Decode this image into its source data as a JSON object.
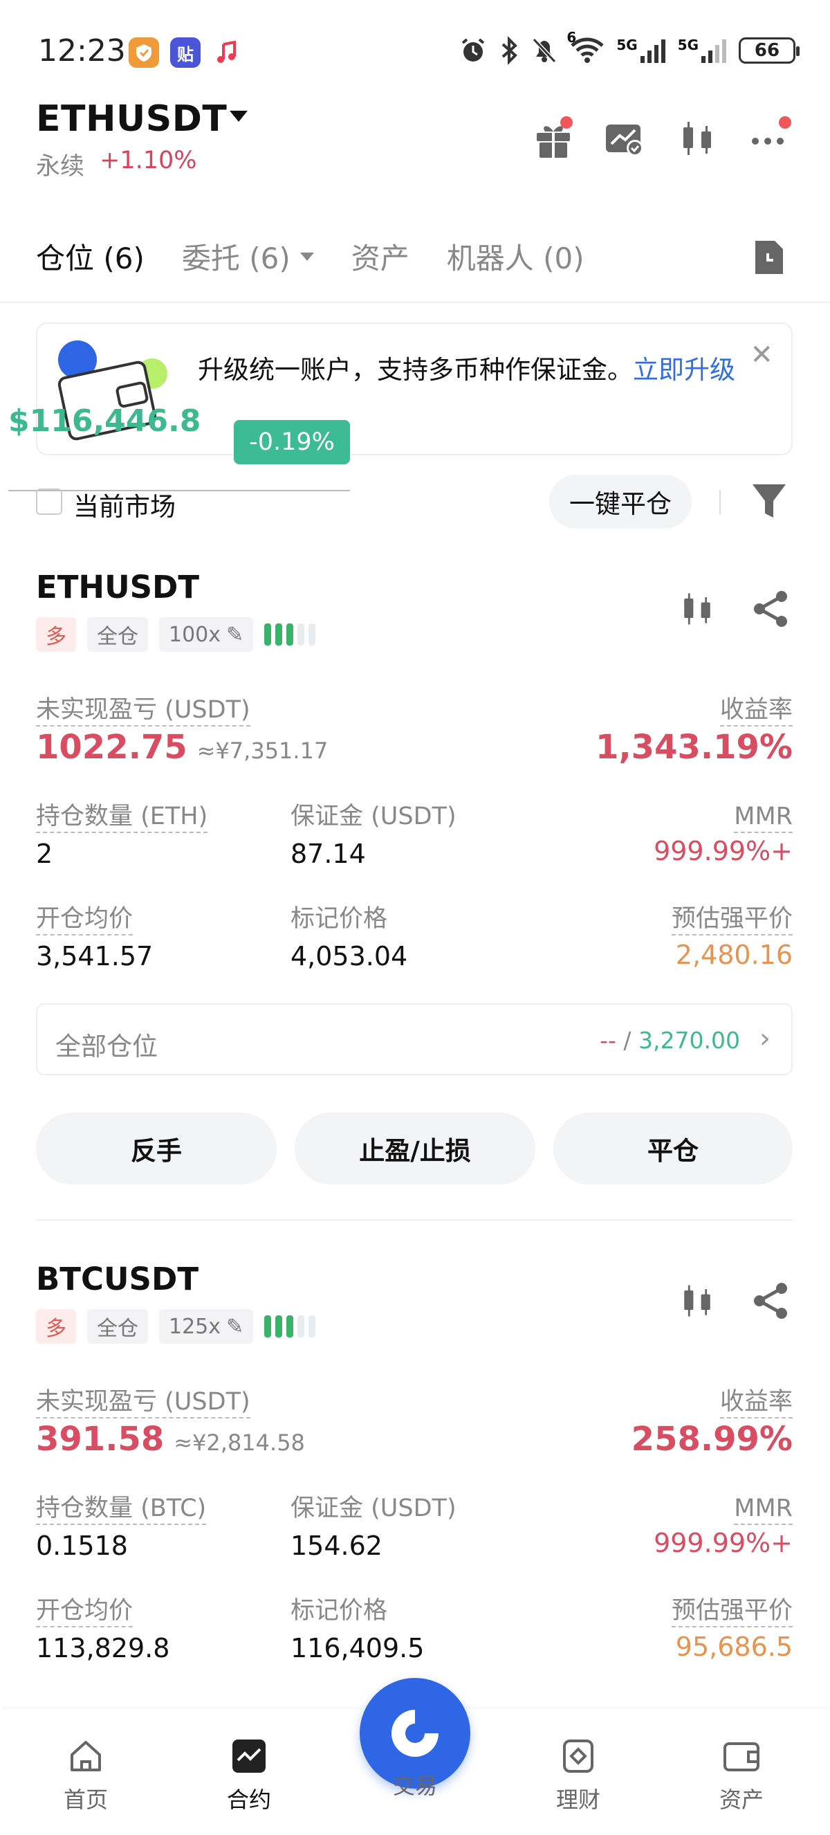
{
  "status": {
    "time": "12:23",
    "battery": "66",
    "signal1": "5G",
    "signal2": "5G",
    "wifi_sub": "6",
    "app2_char": "贴"
  },
  "header": {
    "pair": "ETHUSDT",
    "perp_label": "永续",
    "change": "+1.10%"
  },
  "tabs": [
    {
      "label": "仓位 (6)",
      "active": true
    },
    {
      "label": "委托 (6)",
      "active": false
    },
    {
      "label": "资产",
      "active": false
    },
    {
      "label": "机器人 (0)",
      "active": false
    }
  ],
  "banner": {
    "text": "升级统一账户，支持多币种作保证金。",
    "link": "立即升级"
  },
  "floating": {
    "price": "$116,446.8",
    "change": "-0.19%"
  },
  "filter": {
    "current_market": "当前市场",
    "close_all": "一键平仓"
  },
  "positions": [
    {
      "symbol": "ETHUSDT",
      "side": "多",
      "margin_mode": "全仓",
      "leverage": "100x",
      "pnl_label": "未实现盈亏 (USDT)",
      "pnl": "1022.75",
      "pnl_cny": "≈¥7,351.17",
      "roi_label": "收益率",
      "roi": "1,343.19%",
      "size_label": "持仓数量 (ETH)",
      "size": "2",
      "margin_label": "保证金 (USDT)",
      "margin": "87.14",
      "mmr_label": "MMR",
      "mmr": "999.99%+",
      "entry_label": "开仓均价",
      "entry": "3,541.57",
      "mark_label": "标记价格",
      "mark": "4,053.04",
      "liq_label": "预估强平价",
      "liq": "2,480.16",
      "all_pos_label": "全部仓位",
      "all_pos_a": "--",
      "all_pos_sep": " / ",
      "all_pos_b": "3,270.00",
      "btn_reverse": "反手",
      "btn_tpsl": "止盈/止损",
      "btn_close": "平仓"
    },
    {
      "symbol": "BTCUSDT",
      "side": "多",
      "margin_mode": "全仓",
      "leverage": "125x",
      "pnl_label": "未实现盈亏 (USDT)",
      "pnl": "391.58",
      "pnl_cny": "≈¥2,814.58",
      "roi_label": "收益率",
      "roi": "258.99%",
      "size_label": "持仓数量 (BTC)",
      "size": "0.1518",
      "margin_label": "保证金 (USDT)",
      "margin": "154.62",
      "mmr_label": "MMR",
      "mmr": "999.99%+",
      "entry_label": "开仓均价",
      "entry": "113,829.8",
      "mark_label": "标记价格",
      "mark": "116,409.5",
      "liq_label": "预估强平价",
      "liq": "95,686.5"
    }
  ],
  "nav": [
    {
      "label": "首页",
      "icon": "home-icon"
    },
    {
      "label": "合约",
      "icon": "contract-icon",
      "active": true
    },
    {
      "label": "交易",
      "icon": "trade-icon"
    },
    {
      "label": "理财",
      "icon": "earn-icon"
    },
    {
      "label": "资产",
      "icon": "wallet-icon"
    }
  ],
  "colors": {
    "accent_blue": "#2e66e6",
    "loss_red": "#d94d62",
    "gain_green": "#3db98f",
    "liq_orange": "#e8934f"
  }
}
